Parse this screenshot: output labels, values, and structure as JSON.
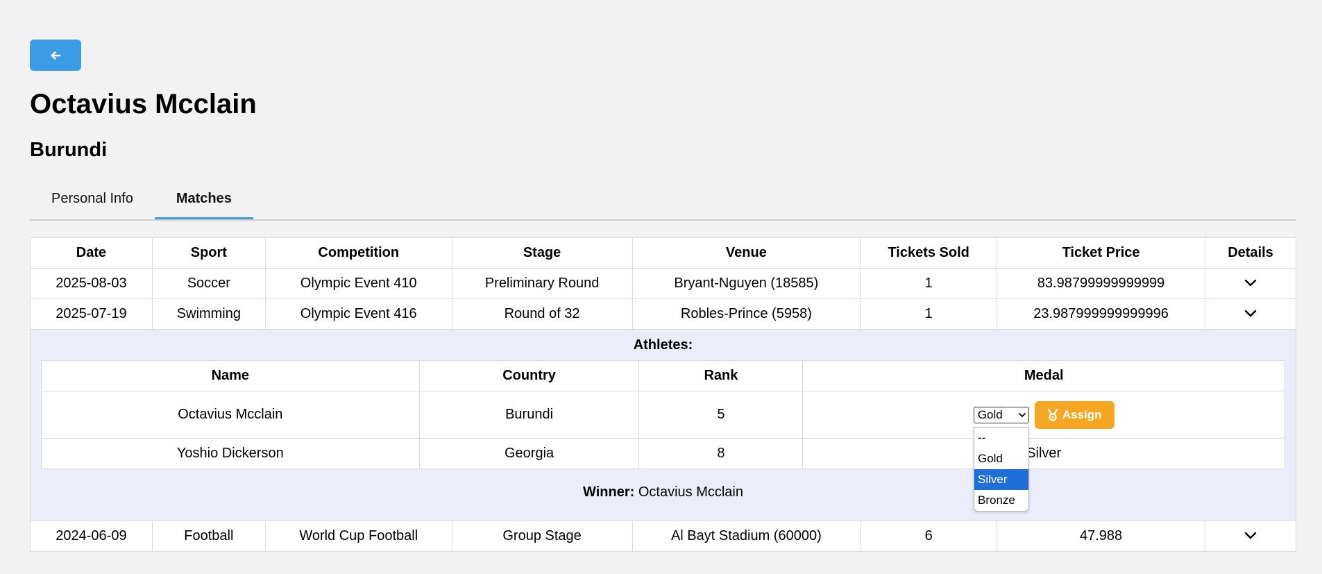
{
  "header": {
    "name": "Octavius Mcclain",
    "country": "Burundi"
  },
  "tabs": [
    {
      "label": "Personal Info",
      "active": false
    },
    {
      "label": "Matches",
      "active": true
    }
  ],
  "matches": {
    "columns": [
      "Date",
      "Sport",
      "Competition",
      "Stage",
      "Venue",
      "Tickets Sold",
      "Ticket Price",
      "Details"
    ],
    "rows": [
      {
        "date": "2025-08-03",
        "sport": "Soccer",
        "competition": "Olympic Event 410",
        "stage": "Preliminary Round",
        "venue": "Bryant-Nguyen (18585)",
        "tickets_sold": "1",
        "ticket_price": "83.98799999999999"
      },
      {
        "date": "2025-07-19",
        "sport": "Swimming",
        "competition": "Olympic Event 416",
        "stage": "Round of 32",
        "venue": "Robles-Prince (5958)",
        "tickets_sold": "1",
        "ticket_price": "23.987999999999996"
      },
      {
        "date": "2024-06-09",
        "sport": "Football",
        "competition": "World Cup Football",
        "stage": "Group Stage",
        "venue": "Al Bayt Stadium (60000)",
        "tickets_sold": "6",
        "ticket_price": "47.988"
      }
    ]
  },
  "details": {
    "title": "Athletes:",
    "columns": [
      "Name",
      "Country",
      "Rank",
      "Medal"
    ],
    "athletes": [
      {
        "name": "Octavius Mcclain",
        "country": "Burundi",
        "rank": "5",
        "medal": ""
      },
      {
        "name": "Yoshio Dickerson",
        "country": "Georgia",
        "rank": "8",
        "medal": "Silver"
      }
    ],
    "medal_select_value": "Gold",
    "assign_label": "Assign",
    "winner_label": "Winner:",
    "winner_value": "Octavius Mcclain",
    "dropdown_options": [
      "--",
      "Gold",
      "Silver",
      "Bronze"
    ],
    "dropdown_highlighted": "Silver"
  },
  "colors": {
    "accent": "#3b9be3",
    "assign": "#f5a623",
    "detail_bg": "#ecedfb",
    "dropdown_highlight": "#1f6fd8"
  }
}
